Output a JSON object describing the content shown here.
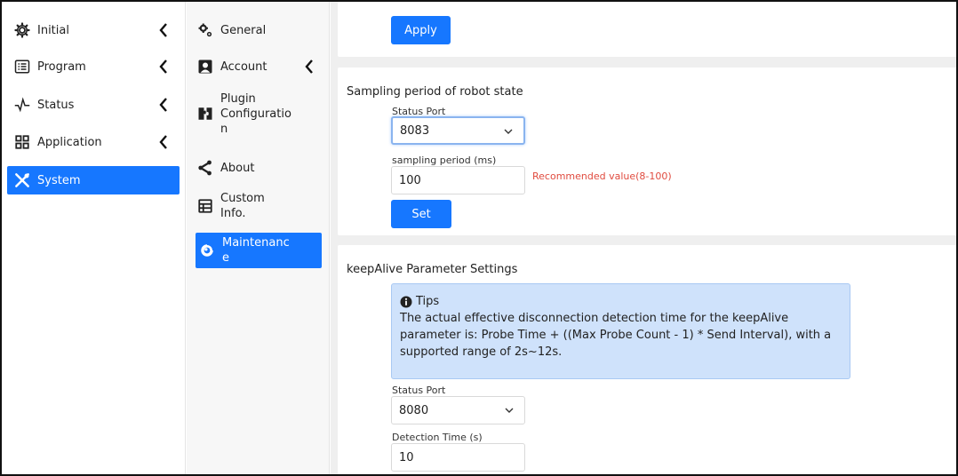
{
  "nav_primary": [
    {
      "label": "Initial",
      "icon": "gear-icon",
      "expandable": true
    },
    {
      "label": "Program",
      "icon": "list-icon",
      "expandable": true
    },
    {
      "label": "Status",
      "icon": "pulse-icon",
      "expandable": true
    },
    {
      "label": "Application",
      "icon": "grid-icon",
      "expandable": true
    },
    {
      "label": "System",
      "icon": "tools-icon",
      "expandable": false,
      "active": true
    }
  ],
  "nav_secondary": [
    {
      "label": "General",
      "icon": "gears-icon"
    },
    {
      "label": "Account",
      "icon": "user-icon",
      "expandable": true
    },
    {
      "label": "Plugin\nConfiguratio\nn",
      "icon": "plugin-icon"
    },
    {
      "label": "About",
      "icon": "share-icon"
    },
    {
      "label": "Custom\nInfo.",
      "icon": "table-icon"
    },
    {
      "label": "Maintenanc\ne",
      "icon": "maintenance-icon",
      "active": true
    }
  ],
  "apply_section": {
    "button": "Apply"
  },
  "sampling_section": {
    "title": "Sampling period of robot state",
    "status_port_label": "Status Port",
    "status_port_value": "8083",
    "period_label": "sampling period (ms)",
    "period_value": "100",
    "period_hint": "Recommended value(8-100)",
    "set_button": "Set"
  },
  "keepalive_section": {
    "title": "keepAlive Parameter Settings",
    "tips_title": "Tips",
    "tips_text": "The actual effective disconnection detection time for the keepAlive parameter is: Probe Time + ((Max Probe Count - 1) * Send Interval), with a supported range of 2s~12s.",
    "status_port_label": "Status Port",
    "status_port_value": "8080",
    "detection_label": "Detection Time (s)",
    "detection_value": "10"
  },
  "colors": {
    "accent": "#1677ff",
    "hint": "#e04b3f",
    "tips_bg": "#cfe2fb"
  }
}
